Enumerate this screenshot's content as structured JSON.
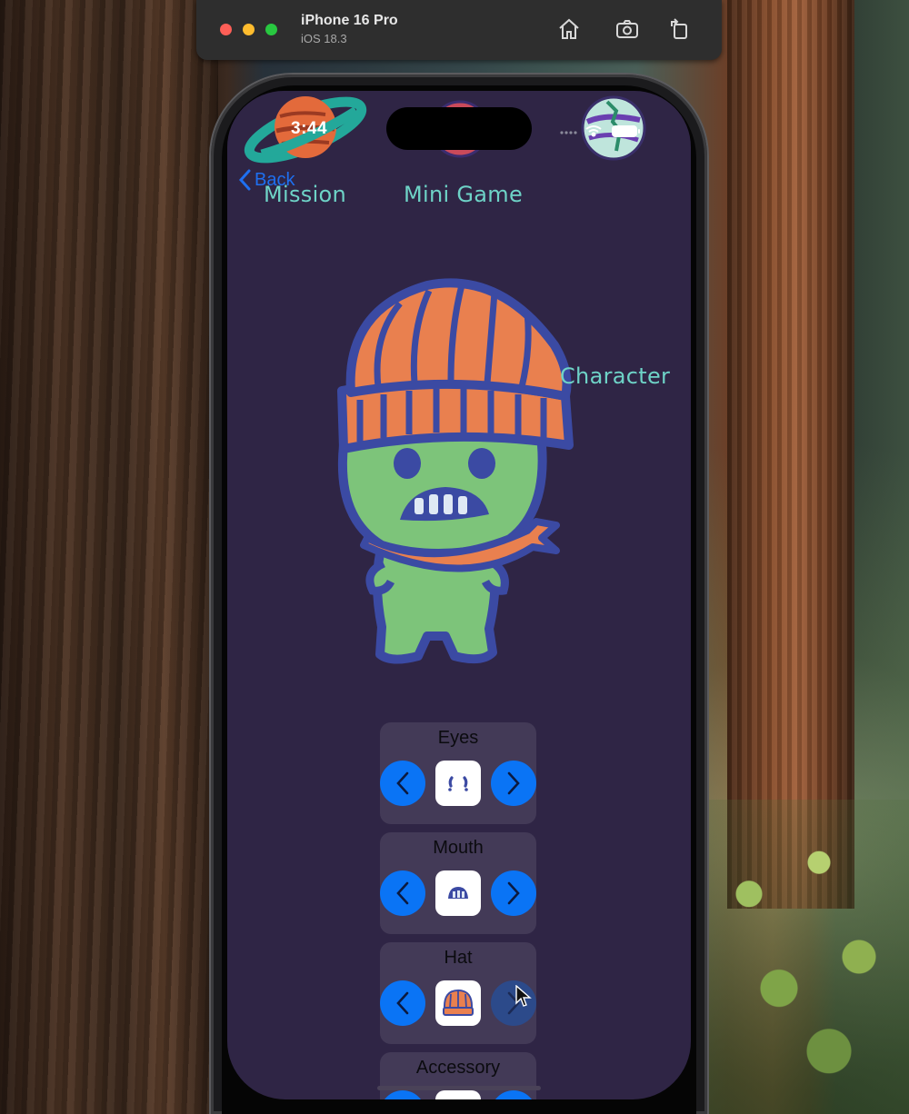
{
  "simulator": {
    "device_name": "iPhone 16 Pro",
    "os_version": "iOS 18.3",
    "icons": [
      "home-icon",
      "screenshot-icon",
      "rotate-icon"
    ]
  },
  "status_bar": {
    "time": "3:44",
    "icons": [
      "wifi-icon",
      "battery-icon"
    ]
  },
  "back_button": {
    "label": "Back"
  },
  "nav": {
    "tabs": [
      {
        "label": "Mission"
      },
      {
        "label": "Mini Game"
      },
      {
        "label": "Character"
      }
    ]
  },
  "pickers": [
    {
      "label": "Eyes"
    },
    {
      "label": "Mouth"
    },
    {
      "label": "Hat"
    },
    {
      "label": "Accessory"
    }
  ],
  "colors": {
    "background": "#2f2545",
    "tab_text": "#6ed3c7",
    "button_blue": "#0a74f5",
    "picker_bg": "#433a57",
    "character_green": "#7dc47a",
    "outline_blue": "#3b4aa3",
    "hat_orange": "#e9804f"
  }
}
